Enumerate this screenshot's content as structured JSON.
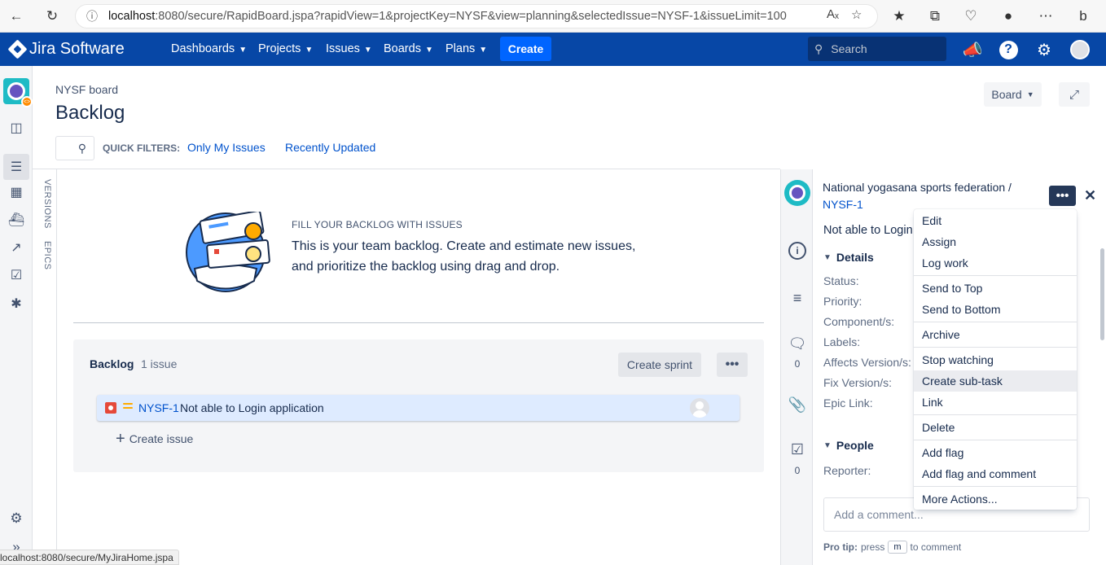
{
  "browser": {
    "url_host": "localhost",
    "url_rest": ":8080/secure/RapidBoard.jspa?rapidView=1&projectKey=NYSF&view=planning&selectedIssue=NYSF-1&issueLimit=100",
    "status_url": "localhost:8080/secure/MyJiraHome.jspa"
  },
  "nav": {
    "logo": "Jira Software",
    "items": [
      "Dashboards",
      "Projects",
      "Issues",
      "Boards",
      "Plans"
    ],
    "create": "Create",
    "search_placeholder": "Search"
  },
  "header": {
    "breadcrumb": "NYSF board",
    "title": "Backlog",
    "board_button": "Board"
  },
  "quick_filters": {
    "label": "QUICK FILTERS:",
    "links": [
      "Only My Issues",
      "Recently Updated"
    ]
  },
  "side_tabs": [
    "VERSIONS",
    "EPICS"
  ],
  "empty_state": {
    "heading": "FILL YOUR BACKLOG WITH ISSUES",
    "body": "This is your team backlog. Create and estimate new issues, and prioritize the backlog using drag and drop."
  },
  "backlog": {
    "title": "Backlog",
    "count": "1 issue",
    "create_sprint": "Create sprint",
    "more": "•••",
    "issues": [
      {
        "key": "NYSF-1",
        "summary": "Not able to Login application"
      }
    ],
    "create_issue": "Create issue"
  },
  "detail": {
    "project": "National yogasana sports federation  /",
    "key": "NYSF-1",
    "summary": "Not able to Login",
    "details_heading": "Details",
    "fields": [
      "Status:",
      "Priority:",
      "Component/s:",
      "Labels:",
      "Affects Version/s:",
      "Fix Version/s:",
      "Epic Link:"
    ],
    "people_heading": "People",
    "people_fields": [
      "Reporter:"
    ],
    "comment_placeholder": "Add a comment...",
    "protip_label": "Pro tip:",
    "protip_press": "press",
    "protip_key": "m",
    "protip_end": "to comment",
    "comments_count": "0",
    "checklist_count": "0"
  },
  "actions_menu": {
    "groups": [
      [
        "Edit",
        "Assign",
        "Log work"
      ],
      [
        "Send to Top",
        "Send to Bottom"
      ],
      [
        "Archive"
      ],
      [
        "Stop watching",
        "Create sub-task",
        "Link"
      ],
      [
        "Delete"
      ],
      [
        "Add flag",
        "Add flag and comment"
      ],
      [
        "More Actions..."
      ]
    ],
    "hovered": "Create sub-task"
  }
}
